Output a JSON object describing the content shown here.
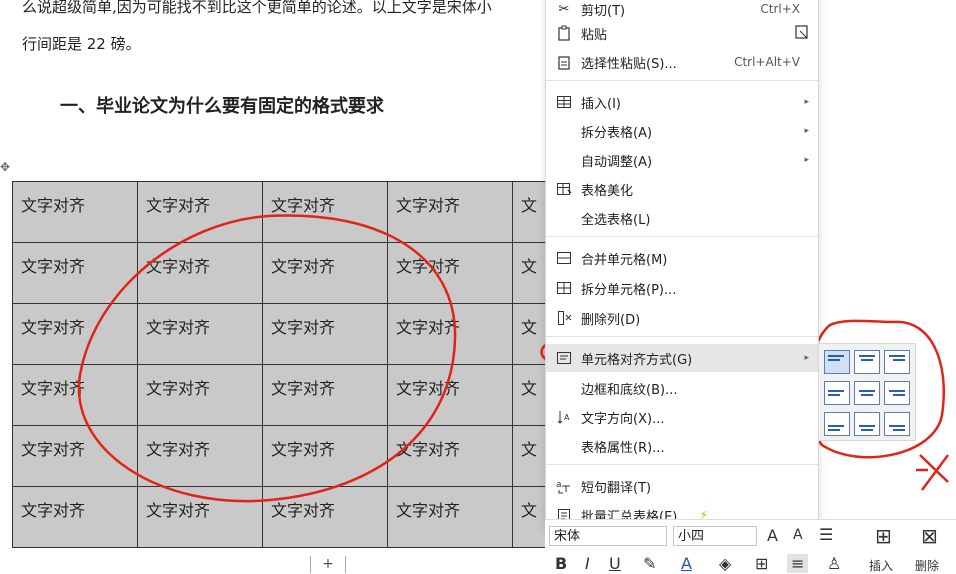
{
  "document": {
    "line1": "么说超级简单,因为可能找不到比这个更简单的论述。以上文字是宋体小",
    "line2": "行间距是 22 磅。",
    "heading": "一、毕业论文为什么要有固定的格式要求",
    "cell_text": "文字对齐",
    "cell_partial": "文",
    "add_row": "+"
  },
  "menu": {
    "cut": "剪切(T)",
    "cut_shortcut": "Ctrl+X",
    "paste": "粘贴",
    "paste_special": "选择性粘贴(S)...",
    "paste_special_shortcut": "Ctrl+Alt+V",
    "insert": "插入(I)",
    "split_table": "拆分表格(A)",
    "auto_fit": "自动调整(A)",
    "beautify": "表格美化",
    "select_all": "全选表格(L)",
    "merge": "合并单元格(M)",
    "split_cells": "拆分单元格(P)...",
    "delete_col": "删除列(D)",
    "cell_align": "单元格对齐方式(G)",
    "borders": "边框和底纹(B)...",
    "text_dir": "文字方向(X)...",
    "table_props": "表格属性(R)...",
    "translate": "短句翻译(T)",
    "batch_sum": "批量汇总表格(E)..."
  },
  "mini_toolbar": {
    "font": "宋体",
    "size": "小四",
    "grow": "A",
    "shrink": "A",
    "bold": "B",
    "italic": "I",
    "underline": "U",
    "insert_label": "插入",
    "delete_label": "删除"
  },
  "colors": {
    "annotation": "#e02418",
    "menu_highlight": "#e6e6e6",
    "cell_bg": "#c9c9c9",
    "align_blue": "#2a5fb0"
  }
}
